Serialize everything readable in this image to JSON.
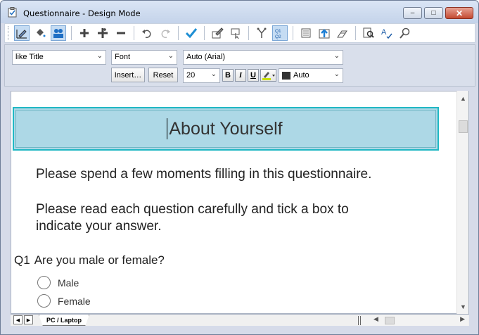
{
  "window": {
    "title": "Questionnaire - Design Mode",
    "controls": {
      "minimize": "‒",
      "maximize": "□",
      "close": "✕"
    }
  },
  "toolbar": {
    "icons": [
      "design-mode-icon",
      "fill-color-icon",
      "users-icon",
      "add-icon",
      "add-multiple-icon",
      "remove-icon",
      "undo-icon",
      "redo-icon",
      "check-icon",
      "edit-properties-icon",
      "insert-object-icon",
      "branch-icon",
      "question-numbering-icon",
      "page-icon",
      "upload-icon",
      "layers-icon",
      "preview-icon",
      "spell-check-icon",
      "search-icon"
    ],
    "numbering_label": "Q1 Q2"
  },
  "format": {
    "style": "like Title",
    "font_label": "Font",
    "font_value": "Auto (Arial)",
    "insert_label": "Insert…",
    "reset_label": "Reset",
    "size_value": "20",
    "bold": "B",
    "italic": "I",
    "underline": "U",
    "color_value": "Auto"
  },
  "document": {
    "title": "About Yourself",
    "intro_1": "Please spend a few moments filling in this questionnaire.",
    "intro_2": "Please read each question carefully and tick a box to",
    "intro_3": "indicate your answer.",
    "question": {
      "number": "Q1",
      "text": "Are you male or female?"
    },
    "options": [
      "Male",
      "Female"
    ]
  },
  "bottom": {
    "sheet_tab": "PC / Laptop"
  },
  "colors": {
    "title_fill": "#add8e6",
    "title_border": "#21b8c4",
    "selected_tool": "#c5dcf3"
  }
}
